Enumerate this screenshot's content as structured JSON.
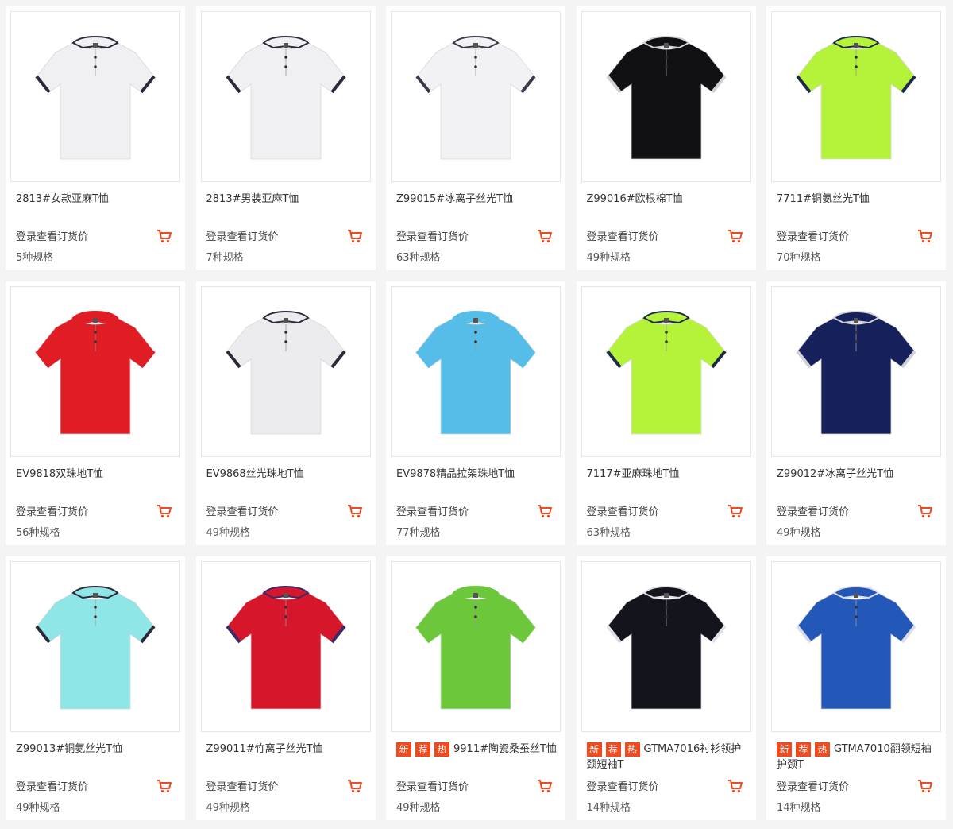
{
  "products": [
    {
      "title": "2813#女款亚麻T恤",
      "price_label": "登录查看订货价",
      "specs": "5种规格",
      "badges": [],
      "body_color": "#f0f0f2",
      "collar_color": "#f0f0f2",
      "trim_color": "#2a2a3a",
      "icon": "polo-shirt-image"
    },
    {
      "title": "2813#男装亚麻T恤",
      "price_label": "登录查看订货价",
      "specs": "7种规格",
      "badges": [],
      "body_color": "#f0f0f2",
      "collar_color": "#f0f0f2",
      "trim_color": "#2a2a3a",
      "icon": "polo-shirt-image"
    },
    {
      "title": "Z99015#冰离子丝光T恤",
      "price_label": "登录查看订货价",
      "specs": "63种规格",
      "badges": [],
      "body_color": "#f2f2f4",
      "collar_color": "#f2f2f4",
      "trim_color": "#3a3a4a",
      "icon": "polo-shirt-image"
    },
    {
      "title": "Z99016#欧根棉T恤",
      "price_label": "登录查看订货价",
      "specs": "49种规格",
      "badges": [],
      "body_color": "#111113",
      "collar_color": "#111113",
      "trim_color": "#cfcfd6",
      "icon": "polo-shirt-image"
    },
    {
      "title": "7711#铜氨丝光T恤",
      "price_label": "登录查看订货价",
      "specs": "70种规格",
      "badges": [],
      "body_color": "#b4f33a",
      "collar_color": "#b4f33a",
      "trim_color": "#1e2a4a",
      "icon": "polo-shirt-image"
    },
    {
      "title": "EV9818双珠地T恤",
      "price_label": "登录查看订货价",
      "specs": "56种规格",
      "badges": [],
      "body_color": "#e01d24",
      "collar_color": "#e01d24",
      "trim_color": "#e01d24",
      "icon": "polo-shirt-image"
    },
    {
      "title": "EV9868丝光珠地T恤",
      "price_label": "登录查看订货价",
      "specs": "49种规格",
      "badges": [],
      "body_color": "#ececee",
      "collar_color": "#ececee",
      "trim_color": "#2a2a3a",
      "icon": "polo-shirt-image"
    },
    {
      "title": "EV9878精品拉架珠地T恤",
      "price_label": "登录查看订货价",
      "specs": "77种规格",
      "badges": [],
      "body_color": "#56bde8",
      "collar_color": "#56bde8",
      "trim_color": "#56bde8",
      "icon": "polo-shirt-image"
    },
    {
      "title": "7117#亚麻珠地T恤",
      "price_label": "登录查看订货价",
      "specs": "63种规格",
      "badges": [],
      "body_color": "#b4f33a",
      "collar_color": "#b4f33a",
      "trim_color": "#1e2a4a",
      "icon": "polo-shirt-image"
    },
    {
      "title": "Z99012#冰离子丝光T恤",
      "price_label": "登录查看订货价",
      "specs": "49种规格",
      "badges": [],
      "body_color": "#16205a",
      "collar_color": "#16205a",
      "trim_color": "#d0d0d8",
      "icon": "polo-shirt-image"
    },
    {
      "title": "Z99013#铜氨丝光T恤",
      "price_label": "登录查看订货价",
      "specs": "49种规格",
      "badges": [],
      "body_color": "#8fe6e6",
      "collar_color": "#8fe6e6",
      "trim_color": "#2a2a3a",
      "icon": "polo-shirt-image"
    },
    {
      "title": "Z99011#竹离子丝光T恤",
      "price_label": "登录查看订货价",
      "specs": "49种规格",
      "badges": [],
      "body_color": "#d6162b",
      "collar_color": "#d6162b",
      "trim_color": "#3a2a6a",
      "icon": "polo-shirt-image"
    },
    {
      "title": "9911#陶瓷桑蚕丝T恤",
      "price_label": "登录查看订货价",
      "specs": "49种规格",
      "badges": [
        "新",
        "荐",
        "热"
      ],
      "body_color": "#6cc83a",
      "collar_color": "#6cc83a",
      "trim_color": "#6cc83a",
      "icon": "polo-shirt-image"
    },
    {
      "title": "GTMA7016衬衫领护颈短袖T",
      "price_label": "登录查看订货价",
      "specs": "14种规格",
      "badges": [
        "新",
        "荐",
        "热"
      ],
      "body_color": "#14141c",
      "collar_color": "#14141c",
      "trim_color": "#e0e0e6",
      "icon": "polo-shirt-image"
    },
    {
      "title": "GTMA7010翻领短袖护颈T",
      "price_label": "登录查看订货价",
      "specs": "14种规格",
      "badges": [
        "新",
        "荐",
        "热"
      ],
      "body_color": "#2458b8",
      "collar_color": "#2458b8",
      "trim_color": "#dcdce6",
      "icon": "polo-shirt-image"
    }
  ],
  "colors": {
    "accent": "#f04a1e",
    "text": "#333333",
    "background": "#f4f4f4"
  },
  "cart_icon": "cart-icon"
}
